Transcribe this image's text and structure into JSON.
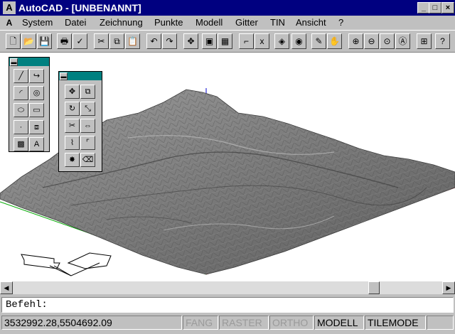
{
  "window": {
    "title": "AutoCAD - [UNBENANNT]",
    "app_icon": "autocad-icon",
    "min": "_",
    "max": "□",
    "close": "×"
  },
  "menu": [
    "System",
    "Datei",
    "Zeichnung",
    "Punkte",
    "Modell",
    "Gitter",
    "TIN",
    "Ansicht",
    "?"
  ],
  "toolbar": {
    "items": [
      {
        "icon": "new-file-icon",
        "glyph": "🗋"
      },
      {
        "icon": "open-folder-icon",
        "glyph": "📂"
      },
      {
        "icon": "save-disk-icon",
        "glyph": "💾"
      },
      {
        "icon": "print-icon",
        "glyph": "🖶"
      },
      {
        "icon": "spell-check-icon",
        "glyph": "✓"
      },
      {
        "icon": "cut-scissors-icon",
        "glyph": "✂"
      },
      {
        "icon": "copy-icon",
        "glyph": "⧉"
      },
      {
        "icon": "paste-clipboard-icon",
        "glyph": "📋"
      },
      {
        "icon": "undo-icon",
        "glyph": "↶"
      },
      {
        "icon": "redo-icon",
        "glyph": "↷"
      },
      {
        "icon": "snap-point-icon",
        "glyph": "✥"
      },
      {
        "icon": "select-window-icon",
        "glyph": "▣"
      },
      {
        "icon": "grid-icon",
        "glyph": "▦"
      },
      {
        "icon": "ortho-icon",
        "glyph": "⌐"
      },
      {
        "icon": "coordinate-xy-icon",
        "glyph": "x"
      },
      {
        "icon": "layers-icon",
        "glyph": "◈"
      },
      {
        "icon": "object-properties-icon",
        "glyph": "◉"
      },
      {
        "icon": "pencil-icon",
        "glyph": "✎"
      },
      {
        "icon": "pan-hand-icon",
        "glyph": "✋"
      },
      {
        "icon": "zoom-in-icon",
        "glyph": "⊕"
      },
      {
        "icon": "zoom-out-icon",
        "glyph": "⊖"
      },
      {
        "icon": "zoom-window-icon",
        "glyph": "⊙"
      },
      {
        "icon": "zoom-all-icon",
        "glyph": "Ⓐ"
      },
      {
        "icon": "aerial-view-icon",
        "glyph": "⊞"
      },
      {
        "icon": "help-icon",
        "glyph": "?"
      }
    ]
  },
  "draw_palette": [
    {
      "icon": "line-icon",
      "glyph": "╱"
    },
    {
      "icon": "polyline-icon",
      "glyph": "↪"
    },
    {
      "icon": "arc-icon",
      "glyph": "◜"
    },
    {
      "icon": "circle-icon",
      "glyph": "◎"
    },
    {
      "icon": "ellipse-icon",
      "glyph": "⬭"
    },
    {
      "icon": "rectangle-icon",
      "glyph": "▭"
    },
    {
      "icon": "point-icon",
      "glyph": "·"
    },
    {
      "icon": "insert-block-icon",
      "glyph": "⧈"
    },
    {
      "icon": "hatch-icon",
      "glyph": "▩"
    },
    {
      "icon": "text-icon",
      "glyph": "A"
    }
  ],
  "modify_palette": [
    {
      "icon": "move-icon",
      "glyph": "✥"
    },
    {
      "icon": "copy-object-icon",
      "glyph": "⧉"
    },
    {
      "icon": "rotate-icon",
      "glyph": "↻"
    },
    {
      "icon": "scale-icon",
      "glyph": "⤡"
    },
    {
      "icon": "trim-icon",
      "glyph": "✂"
    },
    {
      "icon": "stretch-icon",
      "glyph": "⇔"
    },
    {
      "icon": "break-icon",
      "glyph": "⌇"
    },
    {
      "icon": "fillet-icon",
      "glyph": "⌜"
    },
    {
      "icon": "explode-icon",
      "glyph": "✸"
    },
    {
      "icon": "erase-icon",
      "glyph": "⌫"
    }
  ],
  "command": {
    "prompt": "Befehl:"
  },
  "status": {
    "coordinates": "3532992.28,5504692.09",
    "fang": "FANG",
    "raster": "RASTER",
    "ortho": "ORTHO",
    "modell": "MODELL",
    "tilemode": "TILEMODE"
  },
  "colors": {
    "title_bg": "#000080",
    "palette_caption": "#008080",
    "surface": "#c0c0c0",
    "axis_green": "#00aa00",
    "axis_red": "#dd0000",
    "axis_blue": "#0000cc"
  }
}
